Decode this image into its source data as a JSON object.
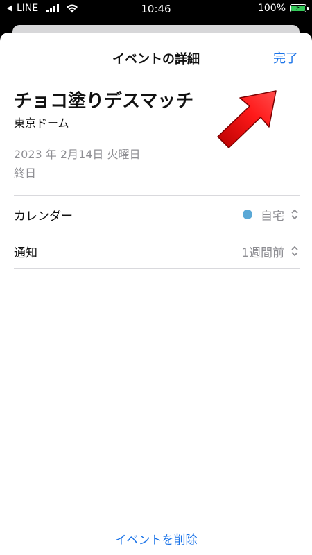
{
  "status_bar": {
    "back_label": "LINE",
    "time": "10:46",
    "battery": "100%"
  },
  "nav": {
    "title": "イベントの詳細",
    "done_label": "完了"
  },
  "event": {
    "title": "チョコ塗りデスマッチ",
    "location": "東京ドーム",
    "date": "2023 年 2月14日 火曜日",
    "all_day": "終日"
  },
  "rows": {
    "calendar": {
      "label": "カレンダー",
      "value": "自宅",
      "color": "#5aa8d6"
    },
    "alert": {
      "label": "通知",
      "value": "1週間前"
    }
  },
  "delete_label": "イベントを削除",
  "accent_color": "#1a73e8",
  "annotation_arrow_color": "#e02020"
}
